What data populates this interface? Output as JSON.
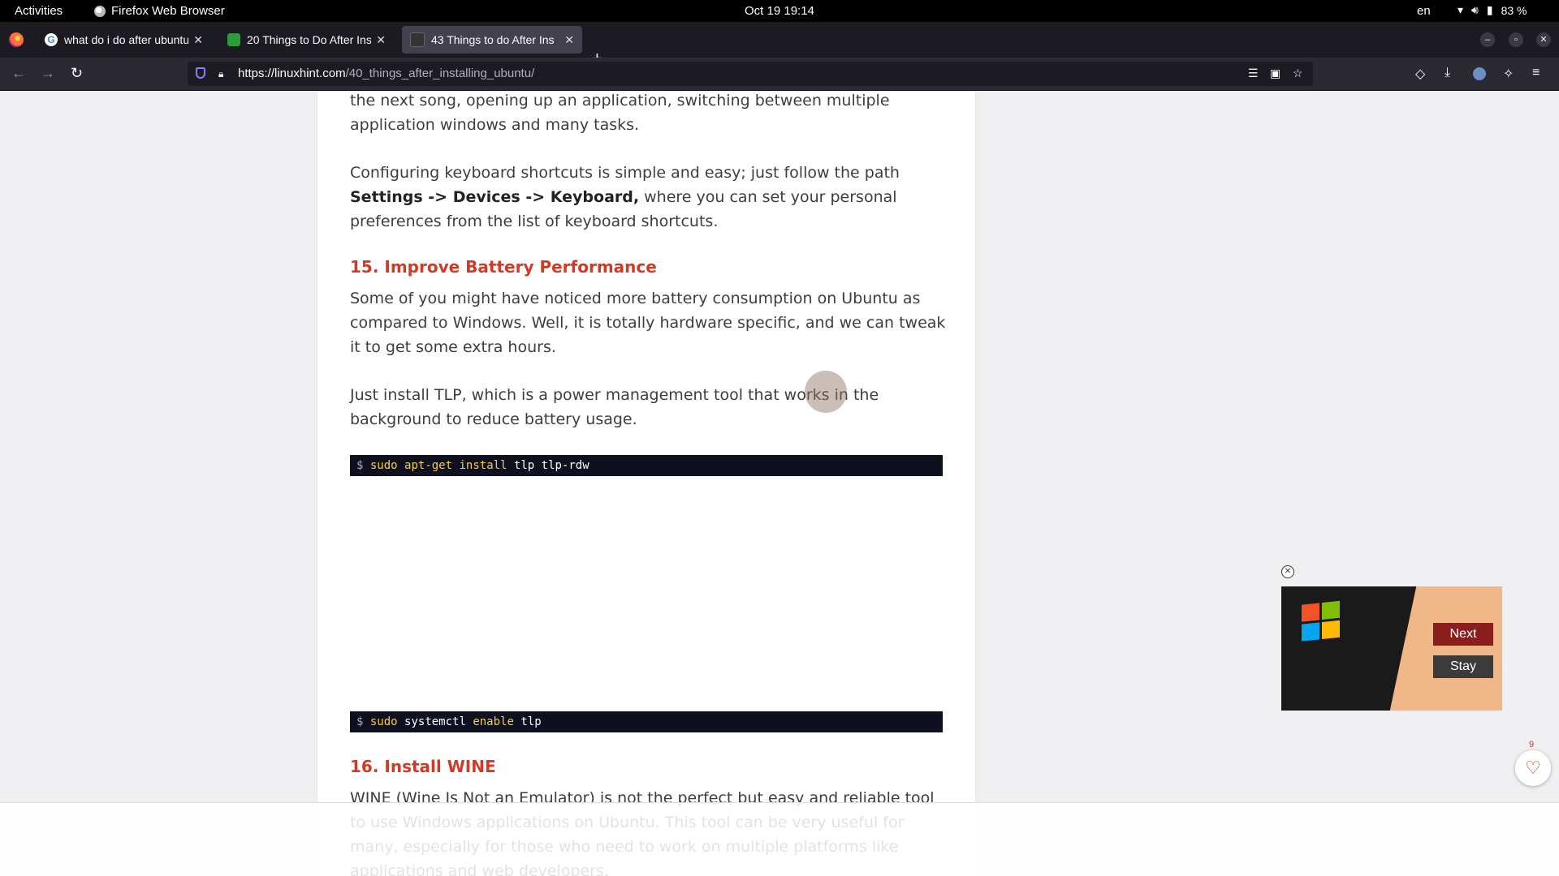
{
  "topbar": {
    "activities": "Activities",
    "app_name": "Firefox Web Browser",
    "clock": "Oct 19  19:14",
    "lang": "en",
    "battery": "83 %"
  },
  "tabs": [
    {
      "title": "what do i do after ubuntu",
      "favicon": "google"
    },
    {
      "title": "20 Things to Do After Ins",
      "favicon": "green-site"
    },
    {
      "title": "43 Things to do After Ins",
      "favicon": "linuxhint",
      "active": true
    }
  ],
  "navbar": {
    "url_host": "https://linuxhint.com",
    "url_path": "/40_things_after_installing_ubuntu/"
  },
  "article": {
    "p1": "the next song, opening up an application, switching between multiple application windows and many tasks.",
    "p2_pre": "Configuring keyboard shortcuts is simple and easy; just follow the path ",
    "p2_bold": "Settings -> Devices -> Keyboard,",
    "p2_post": " where you can set your personal preferences from the list of keyboard shortcuts.",
    "h15": "15. Improve Battery Performance",
    "p3": "Some of you might have noticed more battery consumption on Ubuntu as compared to Windows. Well, it is totally hardware specific, and we can tweak it to get some extra hours.",
    "p4": "Just install TLP, which is a power management tool that works in the background to reduce battery usage.",
    "code1": {
      "prompt": "$",
      "cmd1": "sudo",
      "cmd2": "apt-get",
      "cmd3": "install",
      "rest": "tlp tlp-rdw"
    },
    "code2": {
      "prompt": "$",
      "cmd1": "sudo",
      "cmd2": "systemctl",
      "cmd3": "enable",
      "rest": "tlp"
    },
    "h16": "16. Install WINE",
    "p5": "WINE (Wine Is Not an Emulator) is not the perfect but easy and reliable tool to use Windows applications on Ubuntu. This tool can be very useful for many, especially for those who need to work on multiple platforms like applications and web developers."
  },
  "ad": {
    "next_label": "Next",
    "stay_label": "Stay"
  },
  "favorite": {
    "count": "9"
  },
  "colors": {
    "accent": "#d33a26",
    "code_bg": "#0e0f1f",
    "code_kw": "#f8d03b"
  }
}
